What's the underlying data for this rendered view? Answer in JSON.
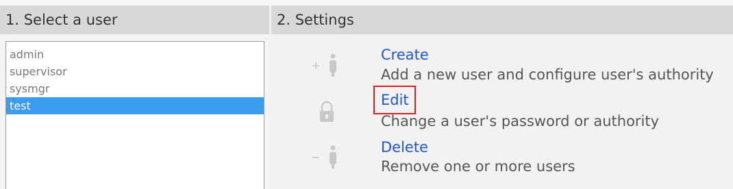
{
  "panels": {
    "select_user": {
      "title": "1. Select a user"
    },
    "settings": {
      "title": "2. Settings"
    }
  },
  "users": [
    {
      "label": "admin",
      "selected": false
    },
    {
      "label": "supervisor",
      "selected": false
    },
    {
      "label": "sysmgr",
      "selected": false
    },
    {
      "label": "test",
      "selected": true
    }
  ],
  "actions": {
    "create": {
      "label": "Create",
      "description": "Add a new user and configure user's authority",
      "icon": "add-user-icon"
    },
    "edit": {
      "label": "Edit",
      "description": "Change a user's password or authority",
      "icon": "lock-icon"
    },
    "delete": {
      "label": "Delete",
      "description": "Remove one or more users",
      "icon": "remove-user-icon"
    }
  },
  "colors": {
    "header_bg": "#d8d8d8",
    "selected_bg": "#3c9cf0",
    "link": "#1f56d0",
    "highlight": "#d81e1e"
  }
}
